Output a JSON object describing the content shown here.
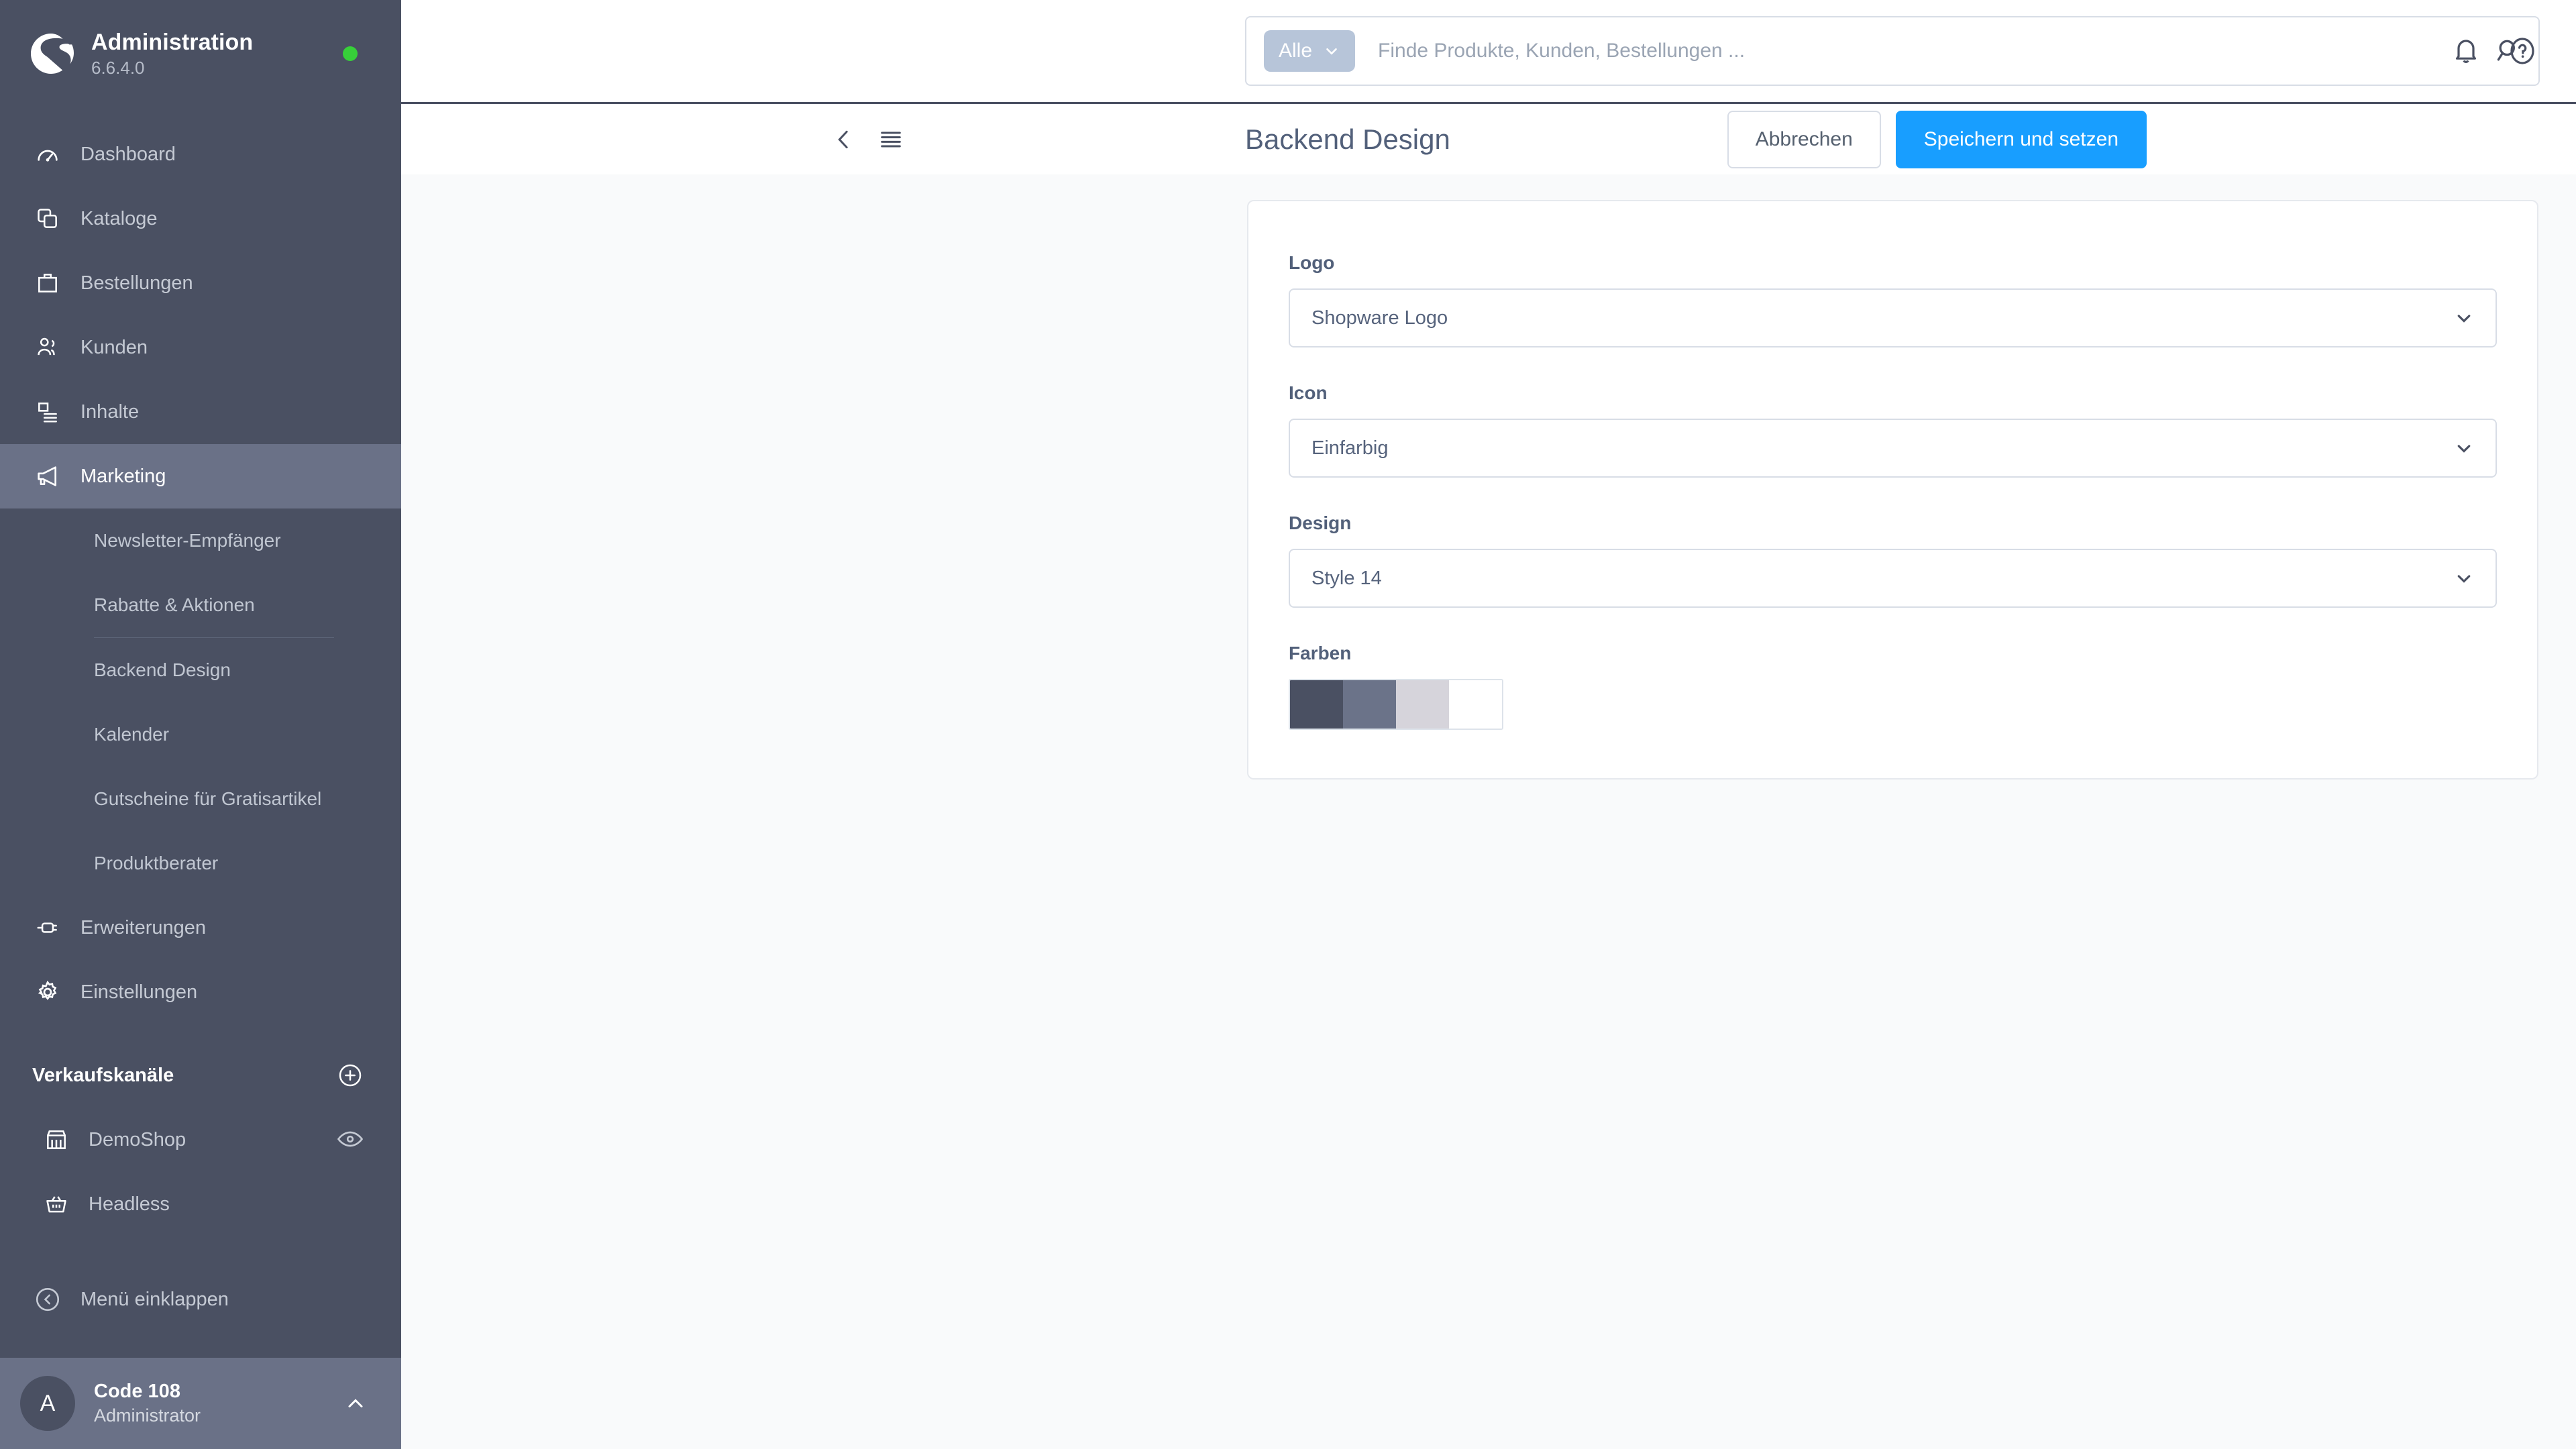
{
  "sidebar": {
    "brand": {
      "title": "Administration",
      "version": "6.6.4.0",
      "status_color": "#37d039",
      "logo_icon": "shopware-logo-icon"
    },
    "nav": [
      {
        "label": "Dashboard",
        "icon": "dashboard-gauge-icon",
        "active": false
      },
      {
        "label": "Kataloge",
        "icon": "catalog-copies-icon",
        "active": false
      },
      {
        "label": "Bestellungen",
        "icon": "orders-bag-icon",
        "active": false
      },
      {
        "label": "Kunden",
        "icon": "customers-people-icon",
        "active": false
      },
      {
        "label": "Inhalte",
        "icon": "content-document-icon",
        "active": false
      },
      {
        "label": "Marketing",
        "icon": "marketing-megaphone-icon",
        "active": true
      }
    ],
    "marketing_submenu": [
      {
        "label": "Newsletter-Empfänger"
      },
      {
        "label": "Rabatte & Aktionen"
      },
      {
        "label": "Backend Design"
      },
      {
        "label": "Kalender"
      },
      {
        "label": "Gutscheine für Gratisartikel"
      },
      {
        "label": "Produktberater"
      }
    ],
    "nav_after": [
      {
        "label": "Erweiterungen",
        "icon": "extensions-plug-icon"
      },
      {
        "label": "Einstellungen",
        "icon": "settings-gear-icon"
      }
    ],
    "sales_channels_header": {
      "label": "Verkaufskanäle",
      "add_icon": "plus-circle-icon"
    },
    "sales_channels": [
      {
        "label": "DemoShop",
        "icon": "storefront-icon",
        "action_icon": "eye-icon"
      },
      {
        "label": "Headless",
        "icon": "basket-icon",
        "action_icon": ""
      }
    ],
    "collapse": {
      "label": "Menü einklappen",
      "icon": "chevron-left-circle-icon"
    },
    "user": {
      "initial": "A",
      "name": "Code 108",
      "role": "Administrator",
      "caret_icon": "chevron-up-icon"
    }
  },
  "topbar": {
    "scope": {
      "label": "Alle",
      "caret_icon": "chevron-down-icon"
    },
    "search_placeholder": "Finde Produkte, Kunden, Bestellungen ...",
    "search_value": "",
    "search_icon": "search-icon",
    "notifications_icon": "bell-icon",
    "help_icon": "help-circle-icon"
  },
  "pagehead": {
    "back_icon": "chevron-left-icon",
    "menu_icon": "list-menu-icon",
    "title": "Backend Design",
    "cancel_label": "Abbrechen",
    "save_label": "Speichern und setzen",
    "primary_color": "#189eff"
  },
  "form": {
    "fields": [
      {
        "label": "Logo",
        "value": "Shopware Logo",
        "caret_icon": "chevron-down-icon"
      },
      {
        "label": "Icon",
        "value": "Einfarbig",
        "caret_icon": "chevron-down-icon"
      },
      {
        "label": "Design",
        "value": "Style 14",
        "caret_icon": "chevron-down-icon"
      }
    ],
    "colors": {
      "label": "Farben",
      "swatches": [
        "#4a5062",
        "#6b7389",
        "#d6d4db",
        "#ffffff"
      ]
    }
  }
}
